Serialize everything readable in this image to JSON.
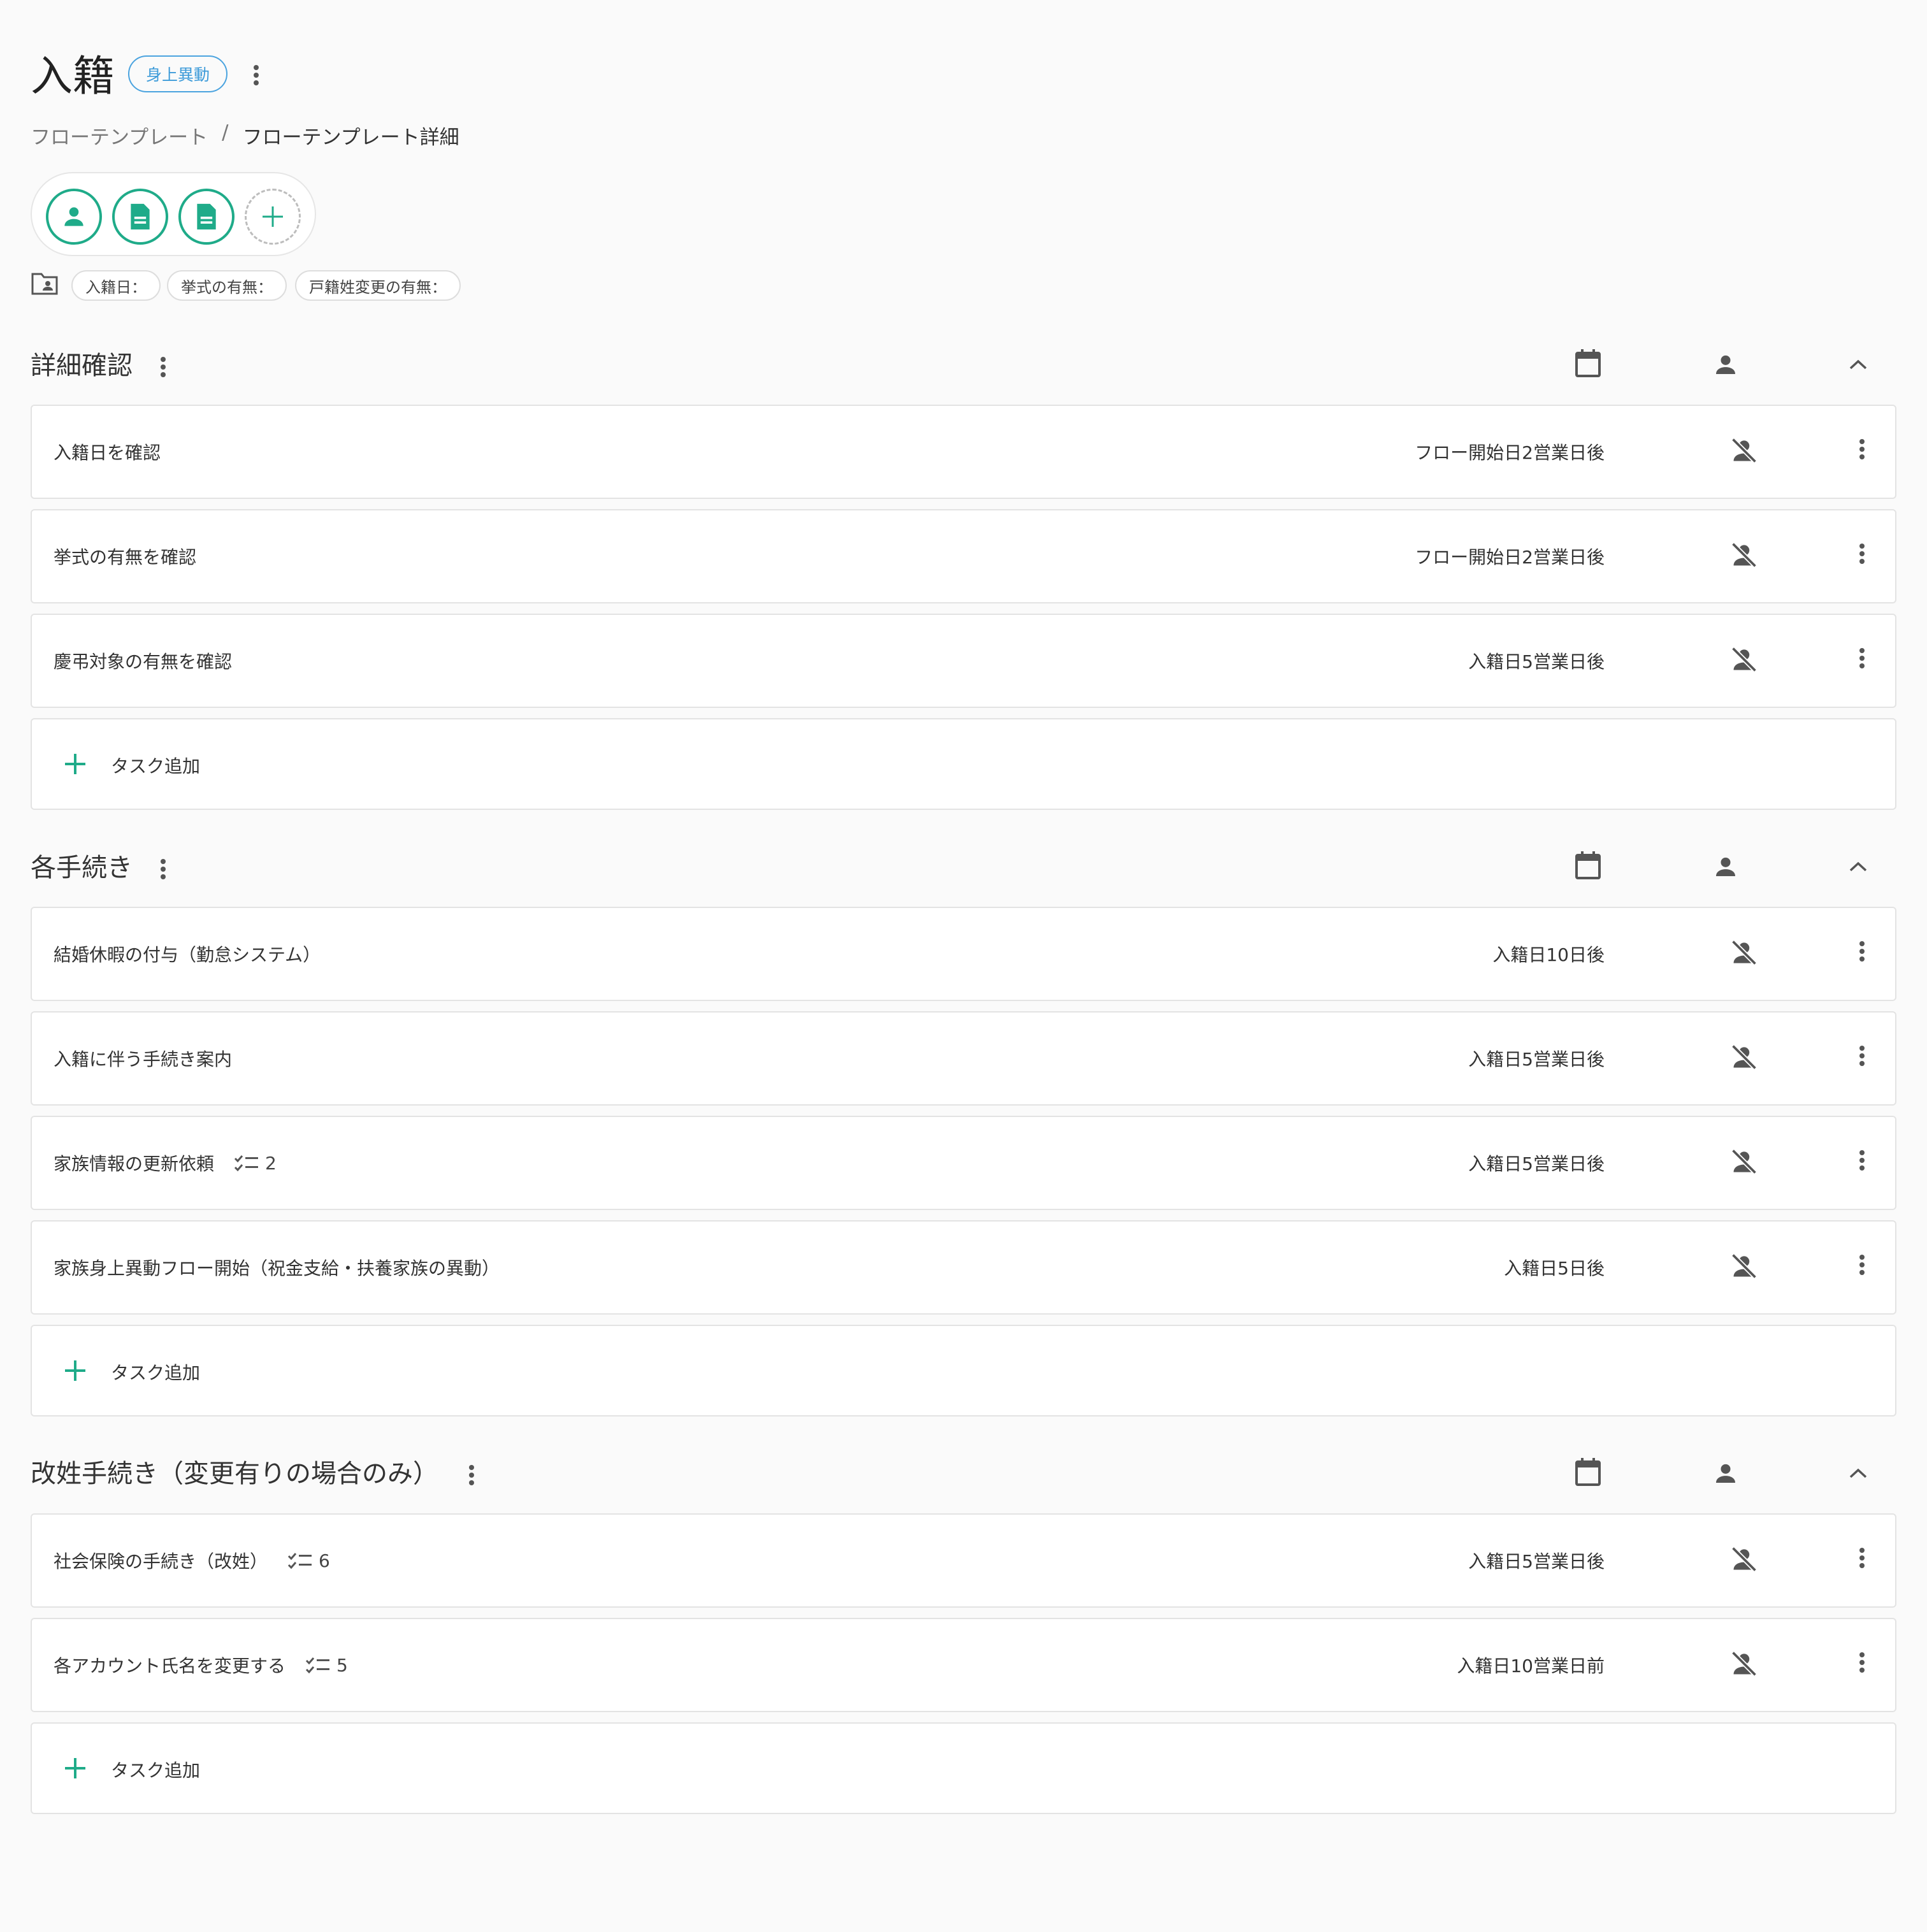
{
  "header": {
    "title": "入籍",
    "category_badge": "身上異動",
    "breadcrumb": {
      "parent": "フローテンプレート",
      "separator": "/",
      "current": "フローテンプレート詳細"
    }
  },
  "members_icons": [
    "person-icon",
    "document-icon",
    "document-icon",
    "add-icon"
  ],
  "fields": [
    "入籍日：",
    "挙式の有無：",
    "戸籍姓変更の有無："
  ],
  "add_task_label": "タスク追加",
  "sections": [
    {
      "title": "詳細確認",
      "tasks": [
        {
          "name": "入籍日を確認",
          "due": "フロー開始日2営業日後"
        },
        {
          "name": "挙式の有無を確認",
          "due": "フロー開始日2営業日後"
        },
        {
          "name": "慶弔対象の有無を確認",
          "due": "入籍日5営業日後"
        }
      ]
    },
    {
      "title": "各手続き",
      "tasks": [
        {
          "name": "結婚休暇の付与（勤怠システム）",
          "due": "入籍日10日後"
        },
        {
          "name": "入籍に伴う手続き案内",
          "due": "入籍日5営業日後"
        },
        {
          "name": "家族情報の更新依頼",
          "checklist": "2",
          "due": "入籍日5営業日後"
        },
        {
          "name": "家族身上異動フロー開始（祝金支給・扶養家族の異動）",
          "due": "入籍日5日後"
        }
      ]
    },
    {
      "title": "改姓手続き（変更有りの場合のみ）",
      "tasks": [
        {
          "name": "社会保険の手続き（改姓）",
          "checklist": "6",
          "due": "入籍日5営業日後"
        },
        {
          "name": "各アカウント氏名を変更する",
          "checklist": "5",
          "due": "入籍日10営業日前"
        }
      ]
    }
  ],
  "colors": {
    "accent": "#1fab89",
    "badge": "#3d9bd9",
    "icon": "#555555"
  }
}
